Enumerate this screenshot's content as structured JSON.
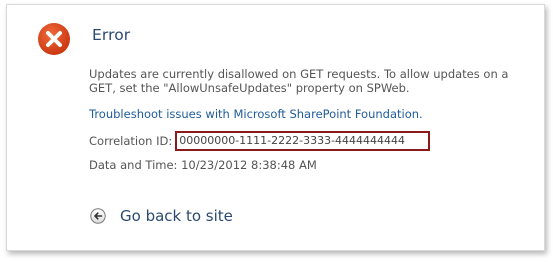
{
  "dialog": {
    "title": "Error",
    "icon": "error-x-icon",
    "message": "Updates are currently disallowed on GET requests. To allow updates on a GET, set the \"AllowUnsafeUpdates\" property on SPWeb.",
    "help_link": "Troubleshoot issues with Microsoft SharePoint Foundation.",
    "correlation_label": "Correlation ID:",
    "correlation_value": "00000000-1111-2222-3333-4444444444",
    "datetime_text": "Data and Time: 10/23/2012 8:38:48 AM",
    "back_label": "Go back to site",
    "back_icon": "back-arrow-icon"
  },
  "colors": {
    "error_red": "#d9401a",
    "title_blue": "#2b4a6f",
    "link_blue": "#1f5c99",
    "highlight_border": "#8b1a1a"
  }
}
